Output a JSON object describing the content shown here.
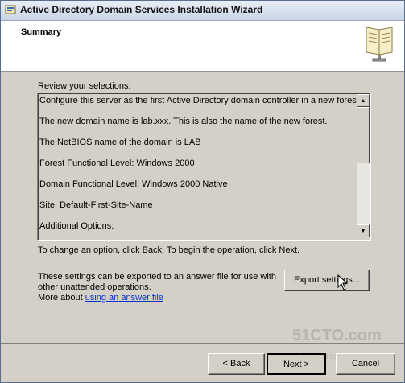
{
  "window": {
    "title": "Active Directory Domain Services Installation Wizard",
    "app_icon": "ad-wizard-icon"
  },
  "header": {
    "title": "Summary",
    "icon": "book-icon"
  },
  "review_label": "Review your selections:",
  "summary_lines": [
    "Configure this server as the first Active Directory domain controller in a new forest.",
    "The new domain name is lab.xxx. This is also the name of the new forest.",
    "The NetBIOS name of the domain is LAB",
    "Forest Functional Level: Windows 2000",
    "Domain Functional Level: Windows 2000 Native",
    "Site: Default-First-Site-Name",
    "Additional Options:"
  ],
  "change_text": "To change an option, click Back. To begin the operation, click Next.",
  "export_text": "These settings can be exported to an answer file for use with other unattended operations.",
  "more_about_prefix": "More about ",
  "answer_file_link": "using an answer file",
  "buttons": {
    "export": "Export settings...",
    "back": "< Back",
    "next": "Next >",
    "cancel": "Cancel"
  },
  "watermark": {
    "site": "51CTO.com",
    "sub": "技术博客 Blog"
  }
}
